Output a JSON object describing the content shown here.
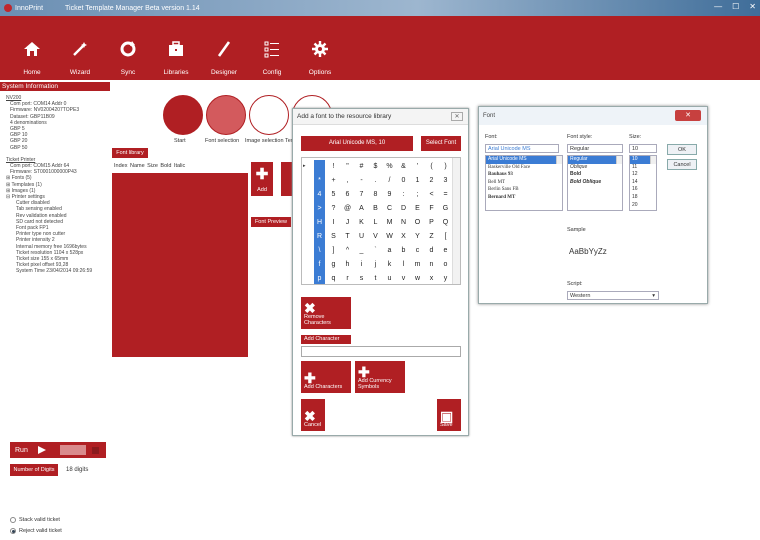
{
  "window": {
    "app_name": "InnoPrint",
    "title": "Ticket Template Manager Beta version 1.14",
    "controls": [
      "—",
      "☐",
      "✕"
    ]
  },
  "toolbar": {
    "items": [
      {
        "label": "Home",
        "icon": "home-icon"
      },
      {
        "label": "Wizard",
        "icon": "wand-icon"
      },
      {
        "label": "Sync",
        "icon": "sync-icon"
      },
      {
        "label": "Libraries",
        "icon": "briefcase-icon"
      },
      {
        "label": "Designer",
        "icon": "pen-icon"
      },
      {
        "label": "Config",
        "icon": "list-config-icon"
      },
      {
        "label": "Options",
        "icon": "gear-icon"
      }
    ]
  },
  "system": {
    "header": "System Information",
    "lines": [
      {
        "t": "NV200",
        "c": "hd"
      },
      {
        "t": "Com port: COM14 Addr 0",
        "c": "i1"
      },
      {
        "t": "Firmware: NV02004207TOPE3",
        "c": "i1"
      },
      {
        "t": "Dataset: GBP11B09",
        "c": "i1"
      },
      {
        "t": "4 denominations",
        "c": "i1"
      },
      {
        "t": "GBP 5",
        "c": "i1"
      },
      {
        "t": "GBP 10",
        "c": "i1"
      },
      {
        "t": "GBP 20",
        "c": "i1"
      },
      {
        "t": "GBP 50",
        "c": "i1"
      },
      {
        "t": "",
        "c": ""
      },
      {
        "t": "Ticket Printer",
        "c": "hd"
      },
      {
        "t": "Com port: COM15 Addr 64",
        "c": "i1"
      },
      {
        "t": "Firmware: ST0001000000P43",
        "c": "i1"
      },
      {
        "t": "⊞ Fonts (5)",
        "c": ""
      },
      {
        "t": "⊞ Templates (1)",
        "c": ""
      },
      {
        "t": "⊞ Images (1)",
        "c": ""
      },
      {
        "t": "⊟ Printer settings",
        "c": ""
      },
      {
        "t": "Cutter disabled",
        "c": "i2"
      },
      {
        "t": "Tab sensing enabled",
        "c": "i2"
      },
      {
        "t": "Rev validation enabled",
        "c": "i2"
      },
      {
        "t": "SD card not detected",
        "c": "i2"
      },
      {
        "t": "Font pack FP1",
        "c": "i2"
      },
      {
        "t": "Printer type non cutter",
        "c": "i2"
      },
      {
        "t": "Printer intensity 2",
        "c": "i2"
      },
      {
        "t": "Internal memory free 1696bytes",
        "c": "i2"
      },
      {
        "t": "Ticket resolution 1104 x 528px",
        "c": "i2"
      },
      {
        "t": "Ticket size 155 x 65mm",
        "c": "i2"
      },
      {
        "t": "Ticket pixel offset 93,28",
        "c": "i2"
      },
      {
        "t": "System Time 23/04/2014 09:26:59",
        "c": "i2"
      }
    ]
  },
  "run": {
    "label": "Run"
  },
  "digits": {
    "label": "Number of Digits",
    "value": "18 digits"
  },
  "options": [
    {
      "label": "Stack valid ticket",
      "checked": false
    },
    {
      "label": "Reject valid ticket",
      "checked": true
    }
  ],
  "steps": [
    {
      "label": "Start"
    },
    {
      "label": "Font selection"
    },
    {
      "label": "Image selection"
    },
    {
      "label": "Tem"
    }
  ],
  "fontlib": {
    "title": "Font library",
    "columns": "Index  Name  Size  Bold  Italic",
    "add_label": "Add",
    "preview_label": "Font Preview"
  },
  "add_dialog": {
    "title": "Add a font to the resource library",
    "font_name": "Arial Unicode MS, 10",
    "select_font": "Select Font",
    "grid": [
      [
        "!",
        "\"",
        "#",
        "$",
        "%",
        "&",
        "'",
        "(",
        ")"
      ],
      [
        "*",
        "+",
        ",",
        "-",
        ".",
        "/",
        "0",
        "1",
        "2",
        "3"
      ],
      [
        "4",
        "5",
        "6",
        "7",
        "8",
        "9",
        ":",
        ";",
        "<",
        "="
      ],
      [
        ">",
        "?",
        "@",
        "A",
        "B",
        "C",
        "D",
        "E",
        "F",
        "G"
      ],
      [
        "H",
        "I",
        "J",
        "K",
        "L",
        "M",
        "N",
        "O",
        "P",
        "Q"
      ],
      [
        "R",
        "S",
        "T",
        "U",
        "V",
        "W",
        "X",
        "Y",
        "Z",
        "["
      ],
      [
        "\\",
        "]",
        "^",
        "_",
        "`",
        "a",
        "b",
        "c",
        "d",
        "e"
      ],
      [
        "f",
        "g",
        "h",
        "i",
        "j",
        "k",
        "l",
        "m",
        "n",
        "o"
      ],
      [
        "p",
        "q",
        "r",
        "s",
        "t",
        "u",
        "v",
        "w",
        "x",
        "y"
      ],
      [
        "z",
        "{",
        "|",
        "}",
        "~"
      ]
    ],
    "remove_label": "Remove Characters",
    "add_char_label": "Add Character",
    "add_chars_label": "Add Characters",
    "add_currency_label": "Add Currency Symbols",
    "cancel_label": "Cancel",
    "save_label": "Save"
  },
  "font_dialog": {
    "title": "Font",
    "font_label": "Font:",
    "font_value": "Arial Unicode MS",
    "fonts": [
      "Arial Unicode MS",
      "Baskerville Old Face",
      "Bauhaus 93",
      "Bell MT",
      "Berlin Sans FB",
      "Bernard MT"
    ],
    "style_label": "Font style:",
    "style_value": "Regular",
    "styles": [
      "Regular",
      "Oblique",
      "Bold",
      "Bold Oblique"
    ],
    "size_label": "Size:",
    "size_value": "10",
    "sizes": [
      "10",
      "11",
      "12",
      "14",
      "16",
      "18",
      "20"
    ],
    "ok_label": "OK",
    "cancel_label": "Cancel",
    "sample_label": "Sample",
    "sample_text": "AaBbYyZz",
    "script_label": "Script:",
    "script_value": "Western"
  }
}
